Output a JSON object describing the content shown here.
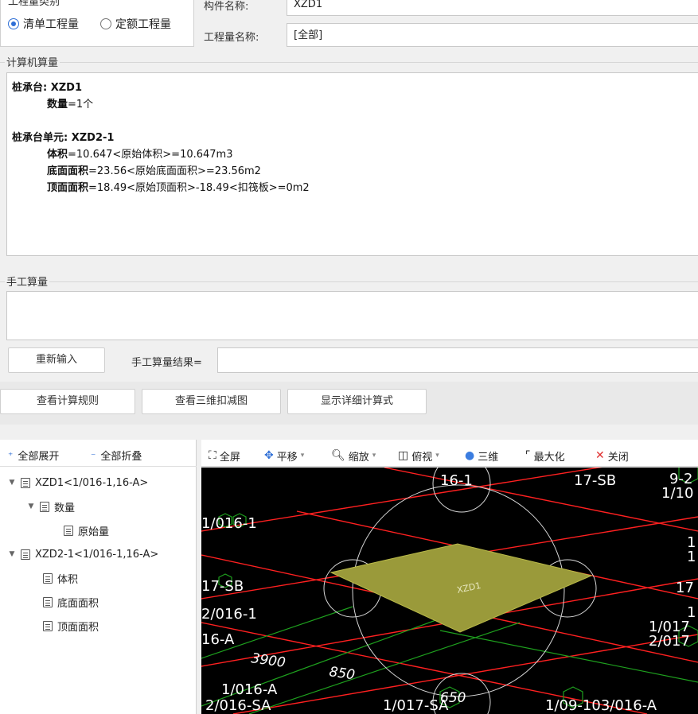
{
  "header": {
    "category_label": "工程量类别",
    "radio_bill": "清单工程量",
    "radio_quota": "定额工程量",
    "component_name_label": "构件名称:",
    "component_name_value": "XZD1",
    "quantity_name_label": "工程量名称:",
    "quantity_name_value": "[全部]"
  },
  "computer_calc": {
    "title": "计算机算量",
    "lines": [
      {
        "bold": "桩承台: XZD1",
        "rest": ""
      },
      {
        "bold": "数量",
        "rest": "=1个"
      },
      {
        "bold": "桩承台单元: XZD2-1",
        "rest": ""
      },
      {
        "bold": "体积",
        "rest": "=10.647<原始体积>=10.647m3"
      },
      {
        "bold": "底面面积",
        "rest": "=23.56<原始底面面积>=23.56m2"
      },
      {
        "bold": "顶面面积",
        "rest": "=18.49<原始顶面积>-18.49<扣筏板>=0m2"
      }
    ]
  },
  "manual_calc": {
    "title": "手工算量",
    "reenter_button": "重新输入",
    "result_label": "手工算量结果="
  },
  "actions": {
    "view_rules": "查看计算规则",
    "view_3d": "查看三维扣减图",
    "show_detail": "显示详细计算式"
  },
  "tree": {
    "expand_all": "全部展开",
    "collapse_all": "全部折叠",
    "items": [
      "XZD1<1/016-1,16-A>",
      "数量",
      "原始量",
      "XZD2-1<1/016-1,16-A>",
      "体积",
      "底面面积",
      "顶面面积"
    ]
  },
  "viewer_toolbar": {
    "fullscreen": "全屏",
    "pan": "平移",
    "zoom": "缩放",
    "view": "俯视",
    "three_d": "三维",
    "maximize": "最大化",
    "close": "关闭"
  },
  "viewer": {
    "component_label": "XZD1",
    "labels": {
      "t1": "16-1",
      "t2": "17-SB",
      "t3": "9-2",
      "t4": "1/10",
      "t5": "1/016-1",
      "t6": "17-SB",
      "t7": "2/016-1",
      "t8": "16-A",
      "t9": "3900",
      "t10": "850",
      "t11": "1/016-A",
      "t12": "2/016-SA",
      "t13": "1/017-SA",
      "t14": "650",
      "t15": "1/09-103/016-A",
      "t16": "1/017",
      "t17": "2/017",
      "t18": "17",
      "t19": "1",
      "t20": "1",
      "t21": "1"
    }
  },
  "colors": {
    "accent": "#2f6fd6",
    "viewer_bg": "#000000",
    "grid_red": "#ff2020",
    "grid_green": "#1ea01e",
    "component_fill": "#9a9a3a",
    "close_red": "#e03030"
  }
}
